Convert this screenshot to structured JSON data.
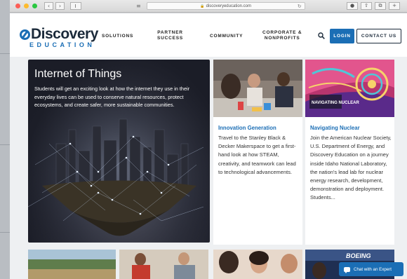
{
  "browser": {
    "url": "discoveryeducation.com",
    "back_glyph": "‹",
    "forward_glyph": "›",
    "reader_glyph": "≡",
    "lock_glyph": "🔒",
    "reload_glyph": "↻",
    "toolbar_icons": [
      "●",
      "⇧",
      "⧉",
      "+"
    ]
  },
  "header": {
    "logo_main": "Discovery",
    "logo_sub": "EDUCATION",
    "nav": {
      "solutions": "SOLUTIONS",
      "partner_line1": "PARTNER",
      "partner_line2": "SUCCESS",
      "community": "COMMUNITY",
      "corporate_line1": "CORPORATE &",
      "corporate_line2": "NONPROFITS"
    },
    "login_label": "LOGIN",
    "contact_label": "CONTACT US"
  },
  "hero": {
    "title": "Internet of Things",
    "text": "Students will get an exciting look at how the internet they use in their everyday lives can be used to conserve natural resources, protect ecosystems, and create safer, more sustainable communities."
  },
  "cards": [
    {
      "title": "Innovation Generation",
      "text": "Travel to the Stanley Black & Decker Makerspace to get a first-hand look at how STEAM, creativity, and teamwork can lead to technological advancements."
    },
    {
      "title": "Navigating Nuclear",
      "text": "Join the American Nuclear Society, U.S. Department of Energy, and Discovery Education on a journey inside Idaho National Laboratory, the nation's lead lab for nuclear energy research, development, demonstration and deployment. Students...",
      "image_caption": "NAVIGATING NUCLEAR"
    }
  ],
  "chat": {
    "label": "Chat with an Expert"
  },
  "colors": {
    "brand_blue": "#1b6eb5",
    "navy": "#1b2a3a"
  }
}
